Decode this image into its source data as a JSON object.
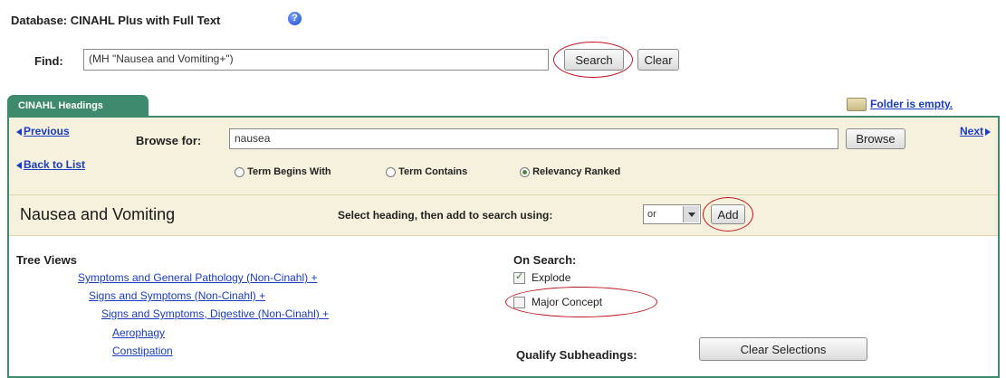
{
  "header": {
    "database_label": "Database: CINAHL Plus with Full Text",
    "help_icon": "help-icon",
    "find_label": "Find:",
    "find_value": "(MH \"Nausea and Vomiting+\")",
    "search_button": "Search",
    "clear_button": "Clear"
  },
  "tab": {
    "label": "CINAHL Headings",
    "folder_icon": "folder-icon",
    "folder_status": "Folder is empty."
  },
  "browse": {
    "previous_link": "Previous",
    "back_link": "Back to List",
    "browse_for_label": "Browse for:",
    "browse_value": "nausea",
    "browse_button": "Browse",
    "next_link": "Next",
    "radio_options": [
      {
        "label": "Term Begins With",
        "selected": false
      },
      {
        "label": "Term Contains",
        "selected": false
      },
      {
        "label": "Relevancy Ranked",
        "selected": true
      }
    ]
  },
  "heading_bar": {
    "title": "Nausea and Vomiting",
    "select_label": "Select heading, then add to search using:",
    "operator_value": "or",
    "add_button": "Add"
  },
  "tree": {
    "title": "Tree Views",
    "items": [
      "Symptoms and General Pathology (Non-Cinahl) +",
      "Signs and Symptoms (Non-Cinahl) +",
      "Signs and Symptoms, Digestive (Non-Cinahl) +",
      "Aerophagy",
      "Constipation"
    ]
  },
  "on_search": {
    "title": "On Search:",
    "explode_label": "Explode",
    "explode_checked": true,
    "major_label": "Major Concept",
    "major_checked": false
  },
  "qualify": {
    "label": "Qualify Subheadings:",
    "clear_button": "Clear Selections"
  },
  "colors": {
    "tab_green": "#3e8a6c",
    "panel_bg": "#f6f1dc",
    "link_blue": "#1a3cc0",
    "highlight_red": "#c0131a"
  }
}
